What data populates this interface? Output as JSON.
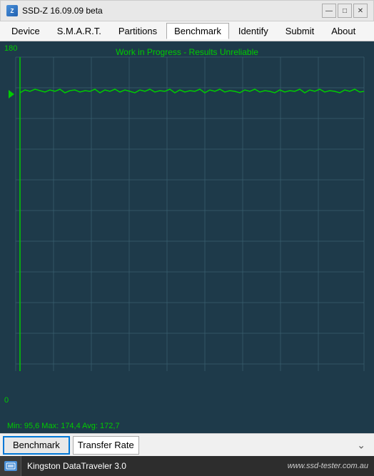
{
  "titleBar": {
    "title": "SSD-Z 16.09.09 beta",
    "iconLabel": "Z",
    "controls": {
      "minimize": "—",
      "maximize": "□",
      "close": "✕"
    }
  },
  "menuBar": {
    "items": [
      {
        "label": "Device",
        "active": false
      },
      {
        "label": "S.M.A.R.T.",
        "active": false
      },
      {
        "label": "Partitions",
        "active": false
      },
      {
        "label": "Benchmark",
        "active": true
      },
      {
        "label": "Identify",
        "active": false
      },
      {
        "label": "Submit",
        "active": false
      },
      {
        "label": "About",
        "active": false
      }
    ]
  },
  "chart": {
    "title": "Work in Progress - Results Unreliable",
    "yAxisTop": "180",
    "yAxisBottom": "0",
    "statsText": "Min: 95,6  Max: 174,4  Avg: 172,7"
  },
  "bottomControls": {
    "benchmarkButton": "Benchmark",
    "typeOptions": [
      "Transfer Rate"
    ],
    "selectedType": "Transfer Rate",
    "dropdownArrow": "⌄"
  },
  "statusBar": {
    "deviceName": "Kingston DataTraveler 3.0",
    "websiteUrl": "www.ssd-tester.com.au"
  }
}
